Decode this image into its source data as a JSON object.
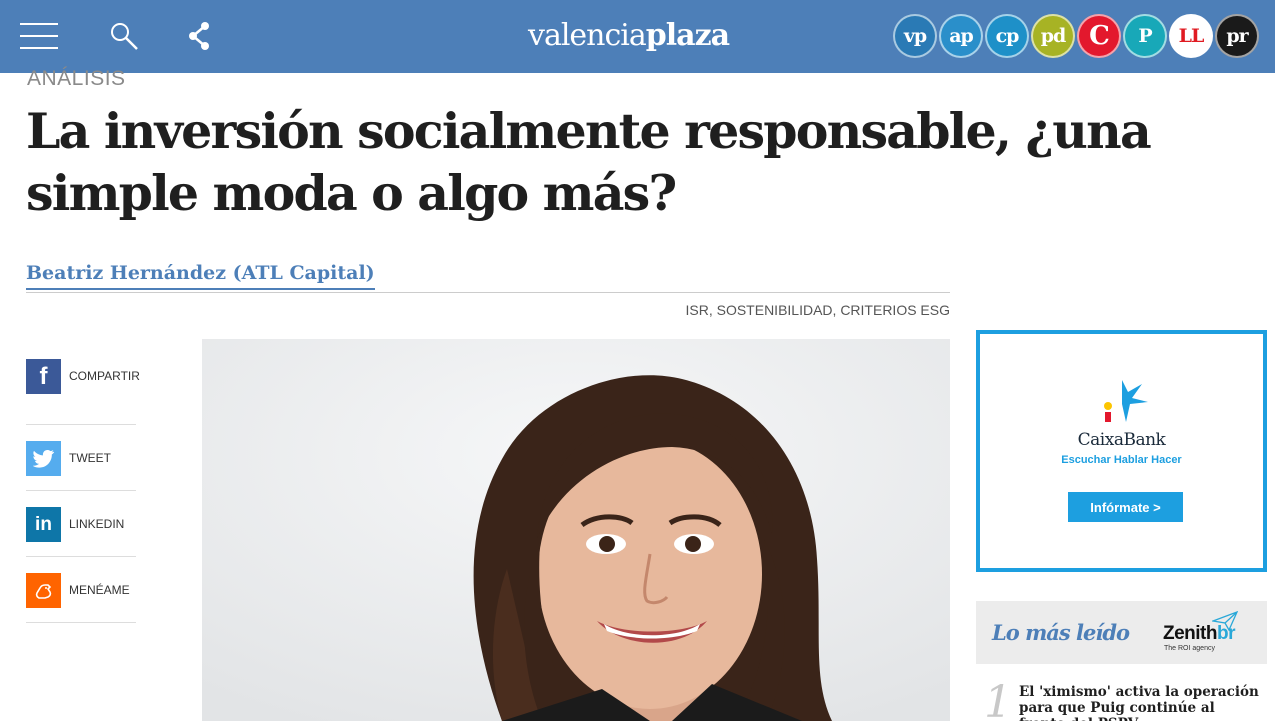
{
  "header": {
    "brand_light": "valencia",
    "brand_bold": "plaza",
    "background": "#4d7fb8",
    "publications": [
      {
        "label": "vp",
        "color": "#2a7ab5"
      },
      {
        "label": "ap",
        "color": "#2a8fca"
      },
      {
        "label": "cp",
        "color": "#1e90c8"
      },
      {
        "label": "pd",
        "color": "#a7b324"
      },
      {
        "label": "C",
        "color": "#e3182d"
      },
      {
        "label": "P",
        "color": "#18a8b8"
      },
      {
        "label": "LL",
        "color": "#e01b22"
      },
      {
        "label": "pr",
        "color": "#1a1a1a"
      }
    ]
  },
  "article": {
    "section": "ANÁLISIS",
    "headline": "La inversión socialmente responsable, ¿una simple moda o algo más?",
    "author": "Beatriz Hernández (ATL Capital)",
    "tags": "ISR, SOSTENIBILIDAD, CRITERIOS ESG"
  },
  "share": [
    {
      "label": "COMPARTIR",
      "icon": "facebook-icon",
      "color": "#3b5998"
    },
    {
      "label": "TWEET",
      "icon": "twitter-icon",
      "color": "#55acee"
    },
    {
      "label": "LINKEDIN",
      "icon": "linkedin-icon",
      "color": "#0e76a8"
    },
    {
      "label": "MENÉAME",
      "icon": "meneame-icon",
      "color": "#ff6400"
    }
  ],
  "ad": {
    "name": "CaixaBank",
    "slogan": "Escuchar Hablar Hacer",
    "button": "Infórmate >",
    "accent": "#1d9fe0"
  },
  "most_read": {
    "title": "Lo más leído",
    "sponsor_main": "Zenith",
    "sponsor_accent": "br",
    "sponsor_sub": "The ROI agency",
    "items": [
      {
        "rank": "1",
        "text": "El 'ximismo' activa la operación para que Puig continúe al frente del PSPV"
      }
    ]
  }
}
